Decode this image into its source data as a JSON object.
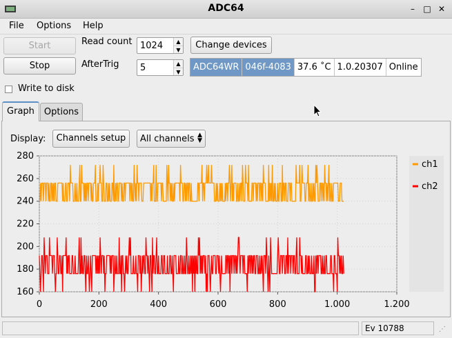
{
  "window": {
    "title": "ADC64",
    "icon": "app-icon",
    "min_icon": "minimize-icon",
    "max_icon": "maximize-icon",
    "close_icon": "close-icon"
  },
  "menu": {
    "file": "File",
    "options": "Options",
    "help": "Help"
  },
  "controls": {
    "start_label": "Start",
    "stop_label": "Stop",
    "read_count_label": "Read count",
    "read_count_value": "1024",
    "aftertrig_label": "AfterTrig",
    "aftertrig_value": "5",
    "change_devices_label": "Change devices",
    "write_to_disk_label": "Write to disk",
    "write_to_disk_checked": false
  },
  "device": {
    "name": "ADC64WR",
    "serial": "046f-4083",
    "temperature": "37.6 ˚C",
    "version": "1.0.20307",
    "status": "Online"
  },
  "tabs": [
    {
      "label": "Graph",
      "active": true
    },
    {
      "label": "Options",
      "active": false
    }
  ],
  "graph_toolbar": {
    "display_label": "Display:",
    "channels_setup_label": "Channels setup",
    "channel_select_value": "All channels"
  },
  "status_bar": {
    "left": "",
    "right": "Ev 10788"
  },
  "chart_data": {
    "type": "line",
    "title": "",
    "xlabel": "",
    "ylabel": "",
    "xlim": [
      0,
      1200
    ],
    "ylim": [
      160,
      280
    ],
    "x_ticks": [
      "0",
      "200",
      "400",
      "600",
      "800",
      "1.000",
      "1.200"
    ],
    "y_ticks": [
      "160",
      "180",
      "200",
      "220",
      "240",
      "260",
      "280"
    ],
    "grid": true,
    "legend": "right",
    "series": [
      {
        "name": "ch1",
        "color": "#ff9900",
        "x_range": [
          0,
          1023
        ],
        "baseline_band": [
          240,
          256
        ],
        "spike_max": 272,
        "note_values": [
          240,
          256,
          272
        ]
      },
      {
        "name": "ch2",
        "color": "#ff0000",
        "x_range": [
          0,
          1023
        ],
        "baseline_band": [
          176,
          192
        ],
        "spike_min": 160,
        "spike_max": 208,
        "note_values": [
          160,
          176,
          192,
          208
        ]
      }
    ]
  }
}
